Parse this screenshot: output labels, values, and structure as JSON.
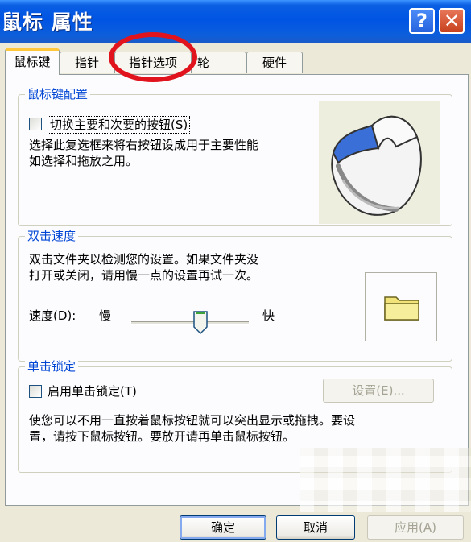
{
  "window": {
    "title": "鼠标 属性",
    "help_glyph": "?",
    "close_glyph": "✕"
  },
  "tabs": [
    {
      "label": "鼠标键",
      "active": true
    },
    {
      "label": "指针",
      "active": false
    },
    {
      "label": "指针选项",
      "active": false
    },
    {
      "label": "轮",
      "active": false
    },
    {
      "label": "硬件",
      "active": false
    }
  ],
  "button_config": {
    "legend": "鼠标键配置",
    "checkbox_label": "切换主要和次要的按钮(S)",
    "checked": false,
    "description_lines": [
      "选择此复选框来将右按钮设成用于主要性能",
      "如选择和拖放之用。"
    ]
  },
  "double_click": {
    "legend": "双击速度",
    "description_lines": [
      "双击文件夹以检测您的设置。如果文件夹没",
      "打开或关闭，请用慢一点的设置再试一次。"
    ],
    "speed_label": "速度(D):",
    "slow_label": "慢",
    "fast_label": "快",
    "speed_value_fraction": 0.6
  },
  "click_lock": {
    "legend": "单击锁定",
    "checkbox_label": "启用单击锁定(T)",
    "checked": false,
    "settings_button": "设置(E)...",
    "description_lines": [
      "使您可以不用一直按着鼠标按钮就可以突出显示或拖拽。要设",
      "置，请按下鼠标按钮。要放开请再单击鼠标按钮。"
    ]
  },
  "footer": {
    "ok": "确定",
    "cancel": "取消",
    "apply": "应用(A)"
  },
  "colors": {
    "titlebar": "#0054E3",
    "legend": "#0046D5",
    "annotation_circle": "#E1141E",
    "active_tab_highlight": "#FFC83C"
  },
  "icons": [
    "help-icon",
    "close-icon",
    "mouse-illustration",
    "folder-icon"
  ]
}
